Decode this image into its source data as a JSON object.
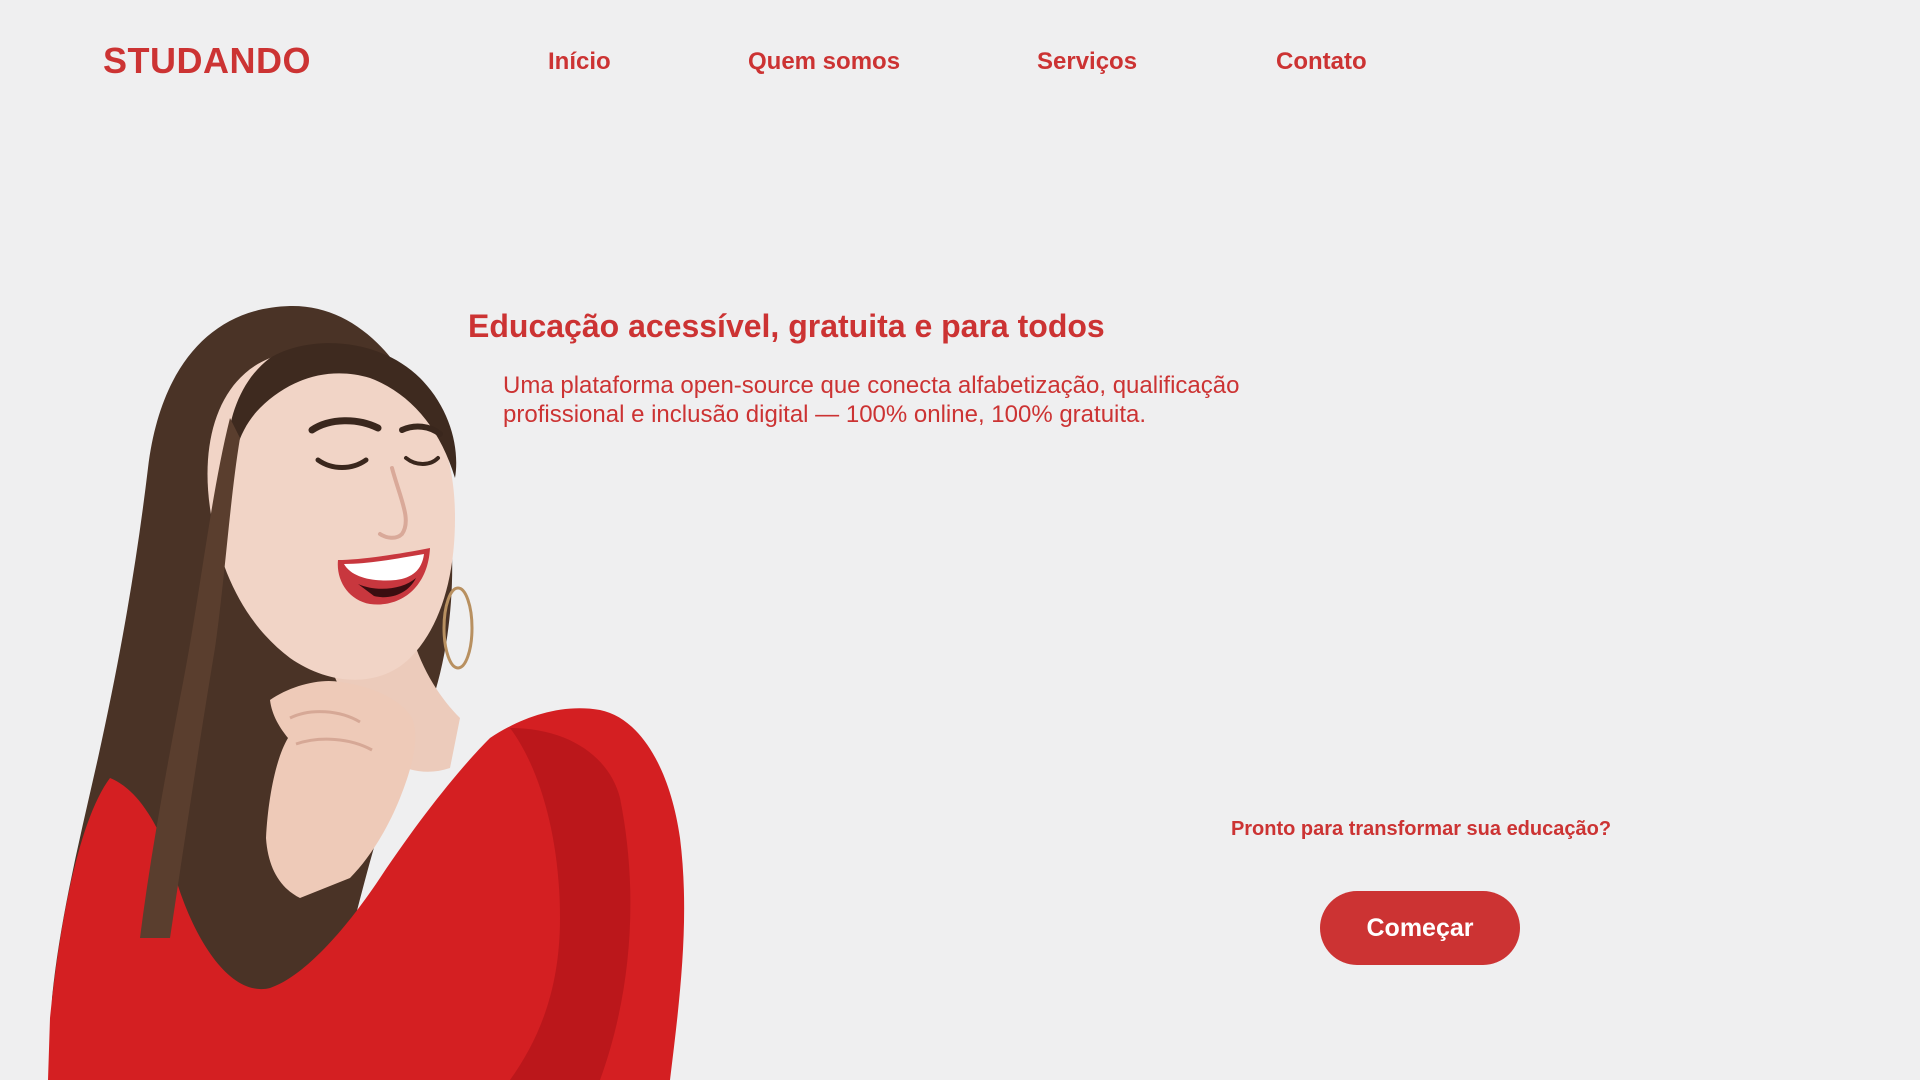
{
  "header": {
    "logo": "STUDANDO",
    "nav": [
      {
        "label": "Início"
      },
      {
        "label": "Quem somos"
      },
      {
        "label": "Serviços"
      },
      {
        "label": "Contato"
      }
    ]
  },
  "hero": {
    "title": "Educação acessível, gratuita e para todos",
    "description": "Uma plataforma open-source que conecta alfabetização, qualificação profissional e inclusão digital — 100% online, 100% gratuita.",
    "image_icon": "smiling-woman-photo"
  },
  "cta": {
    "prompt": "Pronto para transformar sua educação?",
    "button_label": "Começar"
  },
  "colors": {
    "accent": "#cc3333",
    "background": "#efeff0",
    "dress": "#d41f22",
    "hair": "#4a3326",
    "skin": "#f1d4c6"
  }
}
